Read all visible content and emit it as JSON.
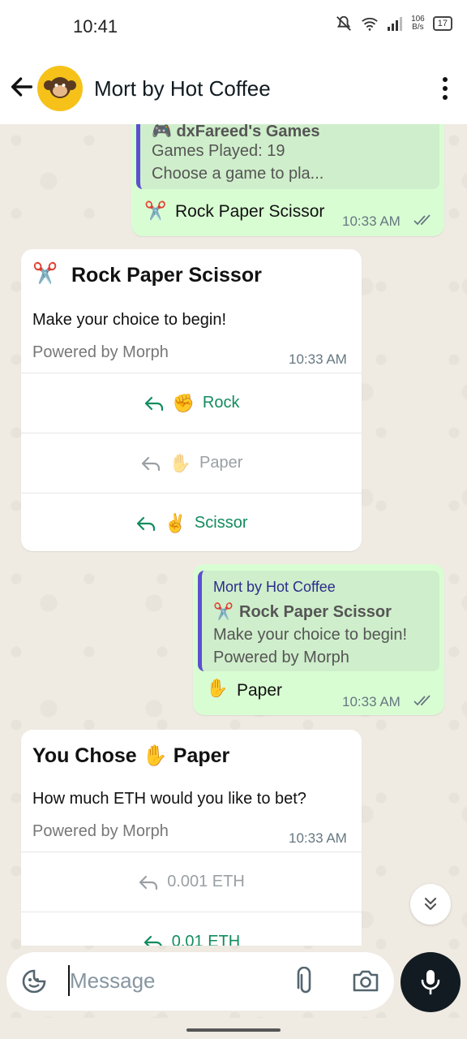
{
  "status_bar": {
    "time": "10:41",
    "net_speed_value": "106",
    "net_speed_unit": "B/s",
    "battery": "17"
  },
  "header": {
    "title": "Mort by Hot Coffee",
    "avatar_icon": "monkey-icon"
  },
  "messages": {
    "m1": {
      "quote_title": "🎮 dxFareed's Games",
      "quote_line1": "Games Played: 19",
      "quote_line2": "Choose a game to pla...",
      "text": "Rock Paper Scissor",
      "emoji": "✂️",
      "time": "10:33 AM"
    },
    "m2": {
      "title": "Rock Paper Scissor",
      "emoji": "✂️",
      "body": "Make your choice to begin!",
      "footer": "Powered by Morph",
      "time": "10:33 AM",
      "buttons": [
        {
          "label": "Rock",
          "emoji": "✊"
        },
        {
          "label": "Paper",
          "emoji": "✋"
        },
        {
          "label": "Scissor",
          "emoji": "✌️"
        }
      ]
    },
    "m3": {
      "quote_sender": "Mort by Hot Coffee",
      "quote_title": "Rock Paper Scissor",
      "quote_emoji": "✂️",
      "quote_line1": "Make your choice to begin!",
      "quote_line2": "Powered by Morph",
      "text": "Paper",
      "emoji": "✋",
      "time": "10:33 AM"
    },
    "m4": {
      "title_prefix": "You Chose",
      "title_emoji": "✋",
      "title_suffix": "Paper",
      "body": "How much ETH would you like to bet?",
      "footer": "Powered by Morph",
      "time": "10:33 AM",
      "buttons": [
        {
          "label": "0.001 ETH"
        },
        {
          "label": "0.01 ETH"
        }
      ]
    }
  },
  "composer": {
    "placeholder": "Message"
  },
  "colors": {
    "outgoing_bubble": "#d9fdd3",
    "button_green": "#128c5e",
    "quote_bar": "#5d4fcf",
    "avatar_bg": "#f6c21a"
  }
}
